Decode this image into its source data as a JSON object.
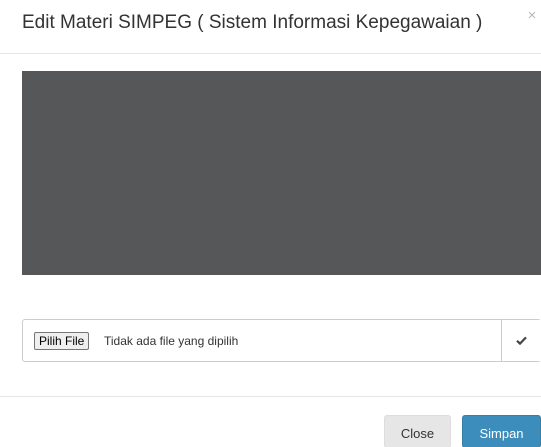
{
  "modal": {
    "title": "Edit Materi SIMPEG ( Sistem Informasi Kepegawaian )",
    "close_glyph": "×"
  },
  "preview": {
    "background_color": "#555758"
  },
  "file_input": {
    "button_label": "Pilih File",
    "status_text": "Tidak ada file yang dipilih",
    "addon_icon": "check-icon"
  },
  "footer": {
    "close_label": "Close",
    "save_label": "Simpan"
  },
  "colors": {
    "primary": "#3c8dbc",
    "default_button": "#e6e6e6"
  }
}
